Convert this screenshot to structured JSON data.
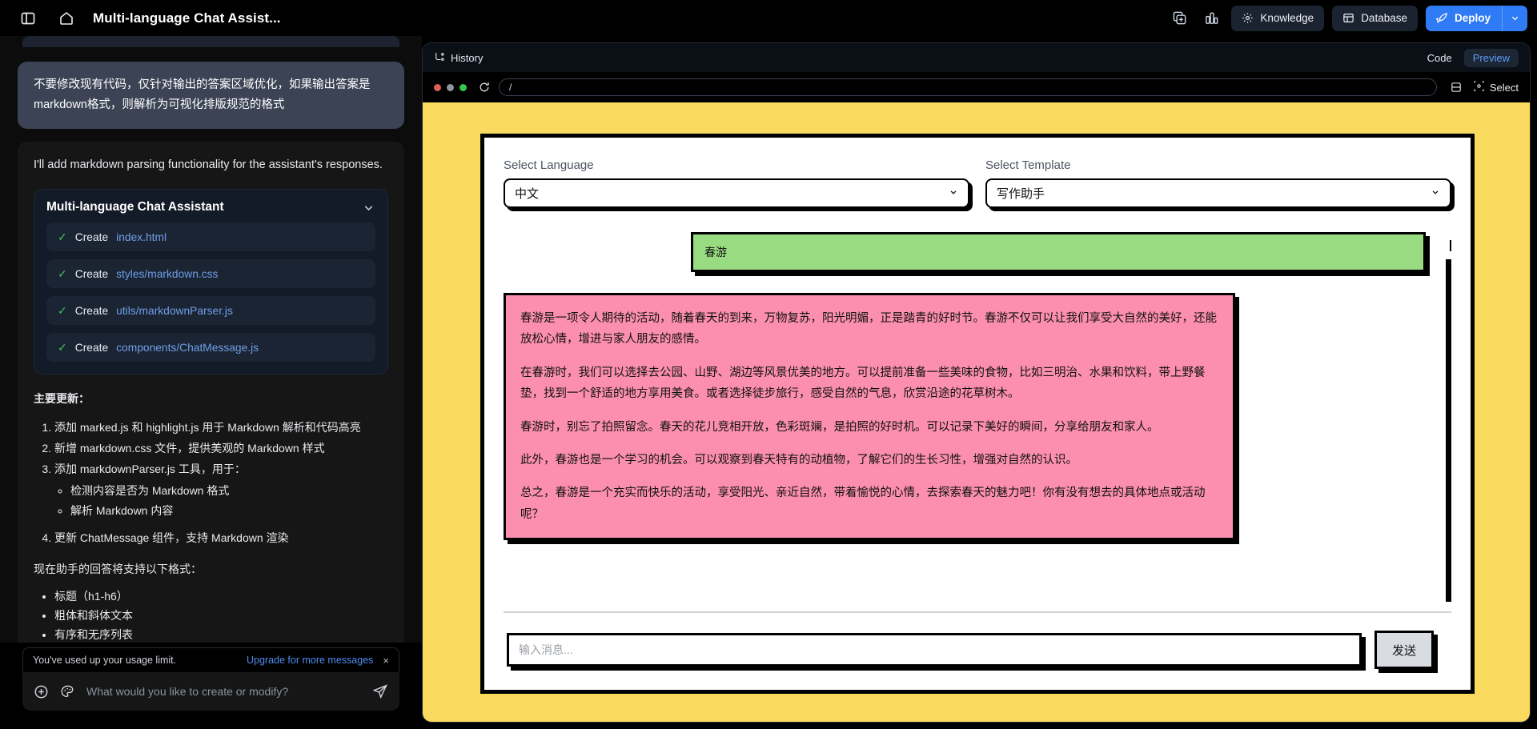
{
  "topbar": {
    "sidebar_toggle_icon": "sidebar-toggle-icon",
    "home_icon": "home-icon",
    "title": "Multi-language Chat Assist...",
    "duplicate_icon": "add-to-collection-icon",
    "analytics_icon": "bar-chart-icon",
    "knowledge_label": "Knowledge",
    "database_label": "Database",
    "deploy_label": "Deploy",
    "deploy_caret": "⌄"
  },
  "sidebar": {
    "user_message": "不要修改现有代码，仅针对输出的答案区域优化，如果输出答案是markdown格式，则解析为可视化排版规范的格式",
    "assistant_intro": "I'll add markdown parsing functionality for the assistant's responses.",
    "card": {
      "title": "Multi-language Chat Assistant",
      "files": [
        {
          "action": "Create",
          "path": "index.html",
          "check": "✓"
        },
        {
          "action": "Create",
          "path": "styles/markdown.css",
          "check": "✓"
        },
        {
          "action": "Create",
          "path": "utils/markdownParser.js",
          "check": "✓"
        },
        {
          "action": "Create",
          "path": "components/ChatMessage.js",
          "check": "✓"
        }
      ]
    },
    "updates_heading": "主要更新：",
    "updates": [
      {
        "text": "添加 marked.js 和 highlight.js 用于 Markdown 解析和代码高亮",
        "sub": []
      },
      {
        "text": "新增 markdown.css 文件，提供美观的 Markdown 样式",
        "sub": []
      },
      {
        "text": "添加 markdownParser.js 工具，用于：",
        "sub": [
          "检测内容是否为 Markdown 格式",
          "解析 Markdown 内容"
        ]
      },
      {
        "text": "更新 ChatMessage 组件，支持 Markdown 渲染",
        "sub": []
      }
    ],
    "formats_heading": "现在助手的回答将支持以下格式：",
    "formats": [
      "标题（h1-h6）",
      "粗体和斜体文本",
      "有序和无序列表"
    ],
    "usage_notice": "You've used up your usage limit.",
    "usage_upgrade": "Upgrade for more messages",
    "usage_close": "×",
    "composer_placeholder": "What would you like to create or modify?",
    "composer_add_icon": "plus-circle-icon",
    "composer_palette_icon": "palette-icon",
    "composer_send_icon": "send-icon"
  },
  "right_panel": {
    "history_label": "History",
    "history_icon": "history-branch-icon",
    "tabs": [
      {
        "label": "Code",
        "active": false
      },
      {
        "label": "Preview",
        "active": true
      }
    ],
    "reload_icon": "reload-icon",
    "url": "/",
    "responsive_icon": "device-frame-icon",
    "select_icon": "select-target-icon",
    "select_label": "Select"
  },
  "preview_app": {
    "background_color": "#fada5e",
    "language": {
      "label": "Select Language",
      "value": "中文",
      "caret": "⌄"
    },
    "template": {
      "label": "Select Template",
      "value": "写作助手",
      "caret": "⌄"
    },
    "user_message": "春游",
    "user_message_color": "#99db80",
    "assistant_message_color": "#fc8fb0",
    "assistant_paragraphs": [
      "春游是一项令人期待的活动，随着春天的到来，万物复苏，阳光明媚，正是踏青的好时节。春游不仅可以让我们享受大自然的美好，还能放松心情，增进与家人朋友的感情。",
      "在春游时，我们可以选择去公园、山野、湖边等风景优美的地方。可以提前准备一些美味的食物，比如三明治、水果和饮料，带上野餐垫，找到一个舒适的地方享用美食。或者选择徒步旅行，感受自然的气息，欣赏沿途的花草树木。",
      "春游时，别忘了拍照留念。春天的花儿竞相开放，色彩斑斓，是拍照的好时机。可以记录下美好的瞬间，分享给朋友和家人。",
      "此外，春游也是一个学习的机会。可以观察到春天特有的动植物，了解它们的生长习性，增强对自然的认识。",
      "总之，春游是一个充实而快乐的活动，享受阳光、亲近自然，带着愉悦的心情，去探索春天的魅力吧！你有没有想去的具体地点或活动呢？"
    ],
    "input_placeholder": "输入消息...",
    "send_label": "发送"
  }
}
